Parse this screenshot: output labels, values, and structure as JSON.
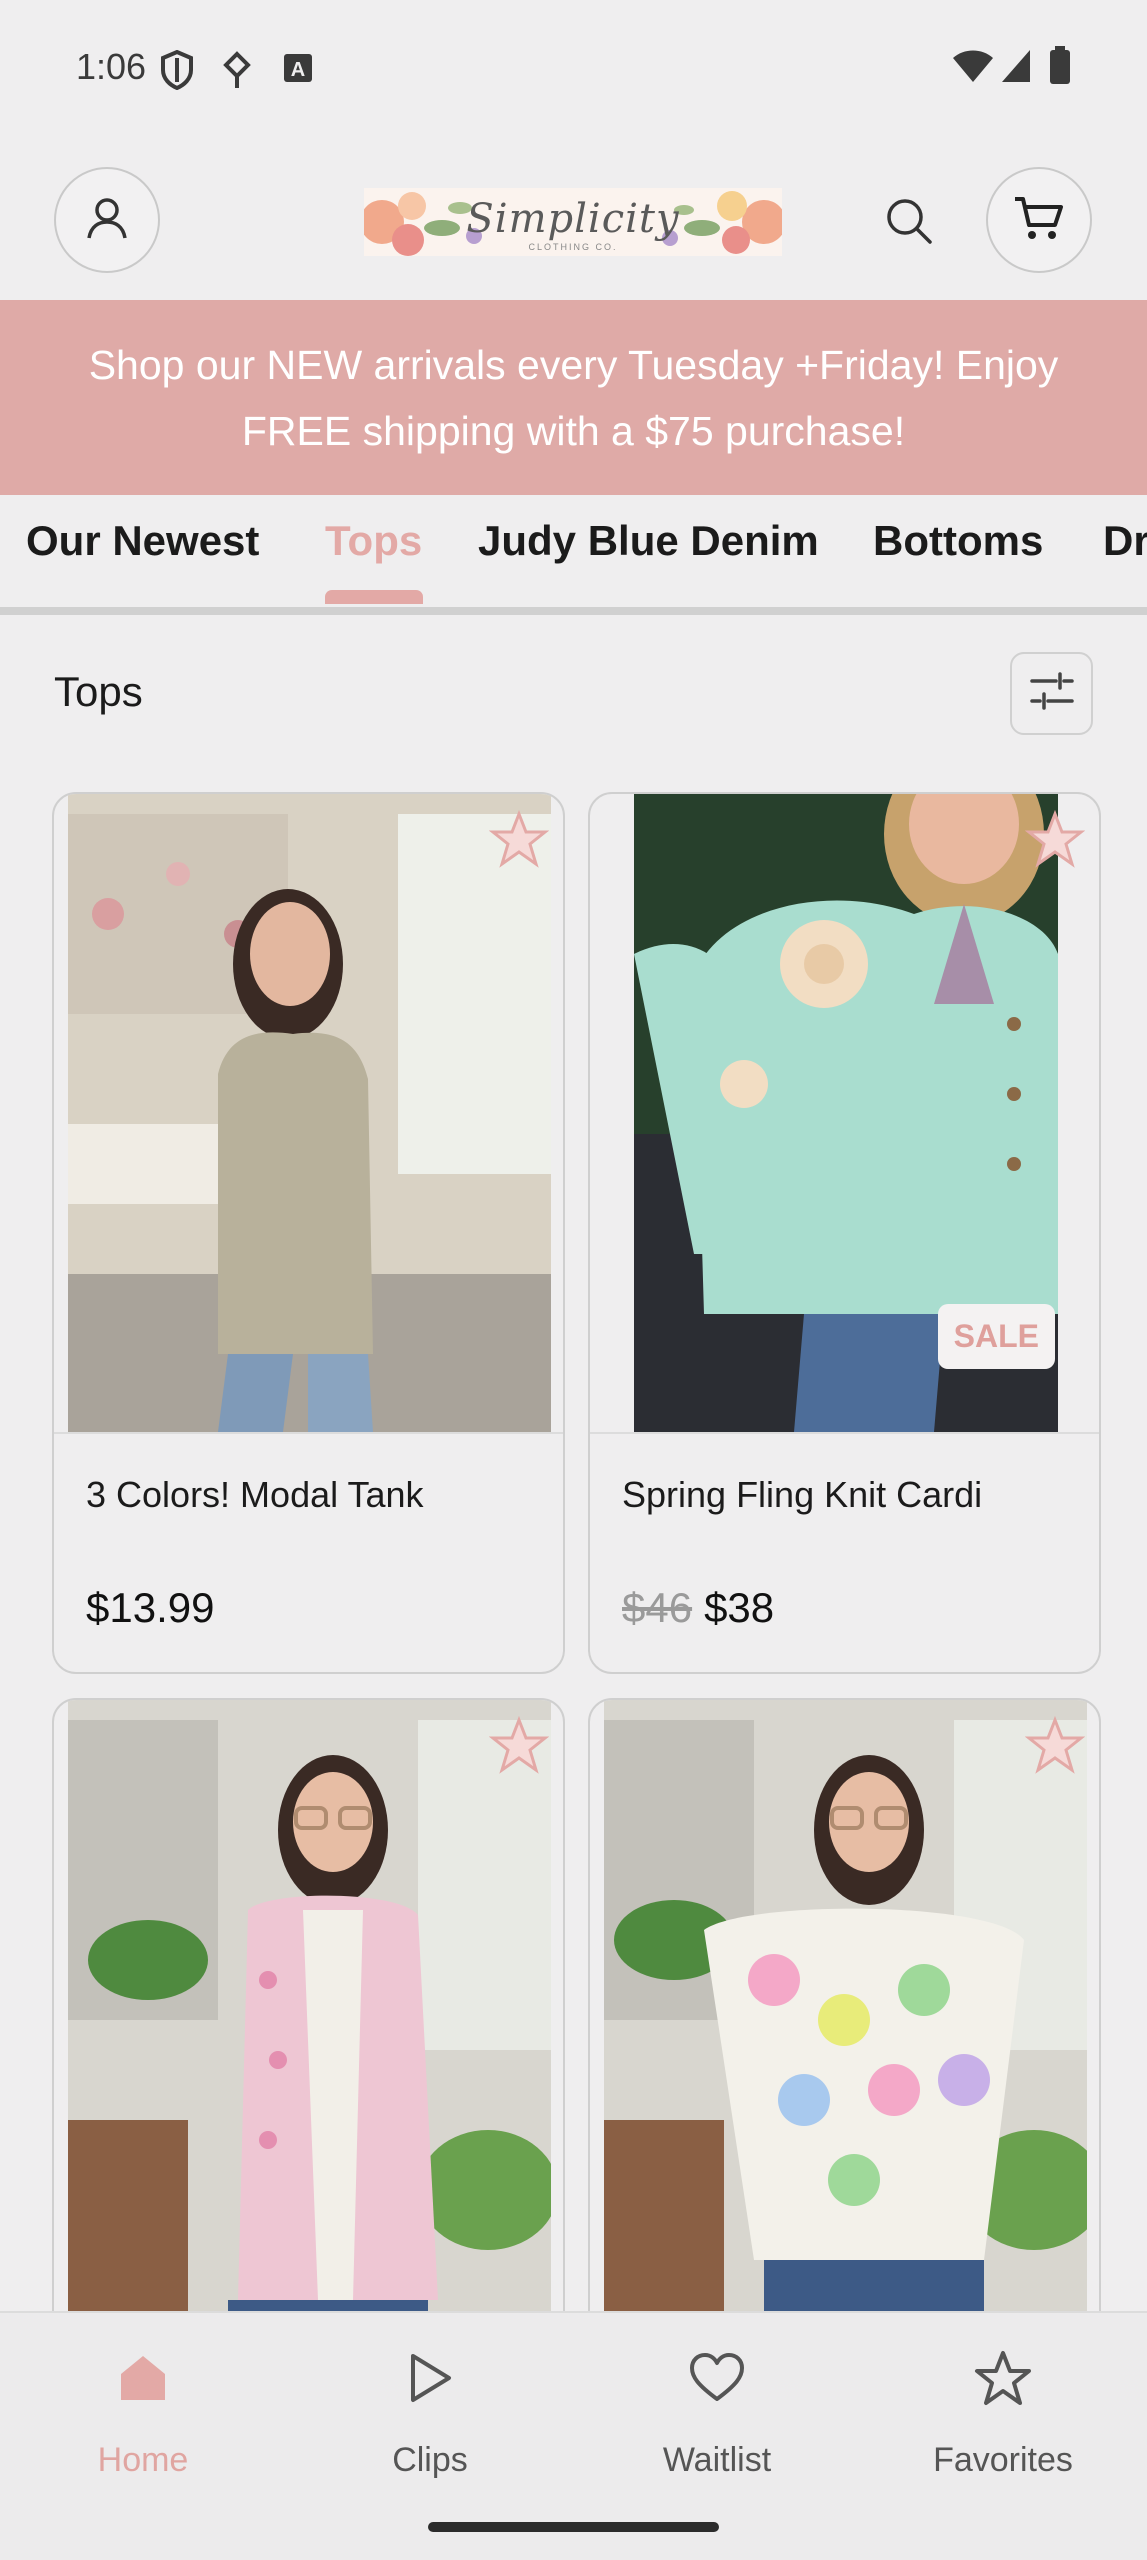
{
  "status_bar": {
    "time": "1:06",
    "icons": [
      "shield-icon",
      "data-saver-icon",
      "a-badge-icon",
      "wifi-icon",
      "signal-icon",
      "battery-icon"
    ]
  },
  "header": {
    "logo_text": "Simplicity",
    "logo_subtext": "CLOTHING CO.",
    "icons": [
      "account-icon",
      "search-icon",
      "cart-icon"
    ]
  },
  "banner": {
    "text": "Shop our NEW arrivals every Tuesday +Friday! Enjoy FREE shipping with a $75 purchase!"
  },
  "tabs": [
    {
      "label": "Our Newest",
      "active": false
    },
    {
      "label": "Tops",
      "active": true
    },
    {
      "label": "Judy Blue Denim",
      "active": false
    },
    {
      "label": "Bottoms",
      "active": false
    },
    {
      "label": "Dr",
      "active": false
    }
  ],
  "section": {
    "title": "Tops",
    "filter_icon": "filter-sliders-icon"
  },
  "products": [
    {
      "name": "3 Colors! Modal Tank",
      "price": "$13.99",
      "old_price": "",
      "badge": ""
    },
    {
      "name": "Spring Fling Knit Cardi",
      "price": "$38",
      "old_price": "$46",
      "badge": "SALE"
    },
    {
      "name": "",
      "price": "",
      "old_price": "",
      "badge": ""
    },
    {
      "name": "",
      "price": "",
      "old_price": "",
      "badge": ""
    }
  ],
  "bottom_nav": [
    {
      "label": "Home",
      "icon": "home-icon",
      "active": true
    },
    {
      "label": "Clips",
      "icon": "play-icon",
      "active": false
    },
    {
      "label": "Waitlist",
      "icon": "heart-icon",
      "active": false
    },
    {
      "label": "Favorites",
      "icon": "star-icon",
      "active": false
    }
  ],
  "colors": {
    "accent_pink": "#e3a9a6",
    "banner_bg": "#dfaaa7",
    "background": "#efeeef"
  }
}
